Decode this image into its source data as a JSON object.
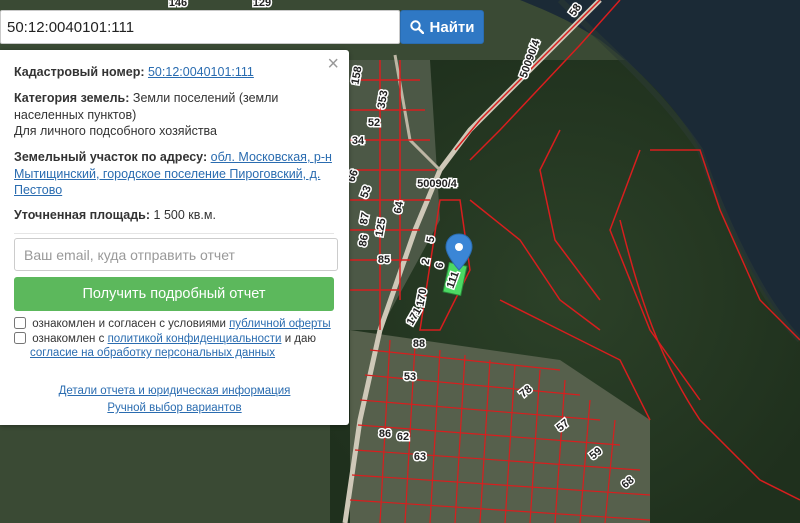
{
  "search": {
    "value": "50:12:0040101:111",
    "button_label": "Найти",
    "button_icon": "search-icon"
  },
  "panel": {
    "close_glyph": "×",
    "cadastral_label": "Кадастровый номер:",
    "cadastral_value": "50:12:0040101:111",
    "category_label": "Категория земель:",
    "category_value": "Земли поселений (земли населенных пунктов)",
    "usage": "Для личного подсобного хозяйства",
    "address_label": "Земельный участок по адресу:",
    "address_value": "обл. Московская, р-н Мытищинский, городское поселение Пироговский, д. Пестово",
    "area_label": "Уточненная площадь:",
    "area_value": "1 500 кв.м.",
    "email_placeholder": "Ваш email, куда отправить отчет",
    "report_button": "Получить подробный отчет",
    "consent1_text": "ознакомлен и согласен с условиями ",
    "consent1_link": "публичной оферты",
    "consent2_text": "ознакомлен с ",
    "consent2_link": "политикой конфиденциальности",
    "consent2_mid": " и даю",
    "consent2_link2": "согласие на обработку персональных данных",
    "details_link": "Детали отчета и юридическая информация",
    "manual_link": "Ручной выбор вариантов"
  },
  "map": {
    "labels": [
      "58",
      "50090/4",
      "50090/4",
      "146",
      "129",
      "158",
      "353",
      "52",
      "34",
      "66",
      "53",
      "87",
      "64",
      "125",
      "86",
      "85",
      "5",
      "2",
      "6",
      "111",
      "170",
      "171",
      "88",
      "53",
      "78",
      "86",
      "57",
      "59",
      "62",
      "63",
      "68"
    ],
    "colors": {
      "water": "#1b2a36",
      "forest": "#243622",
      "parcel": "#d81e1e",
      "marker": "#3b86d6",
      "highlight": "#4cd964"
    }
  }
}
